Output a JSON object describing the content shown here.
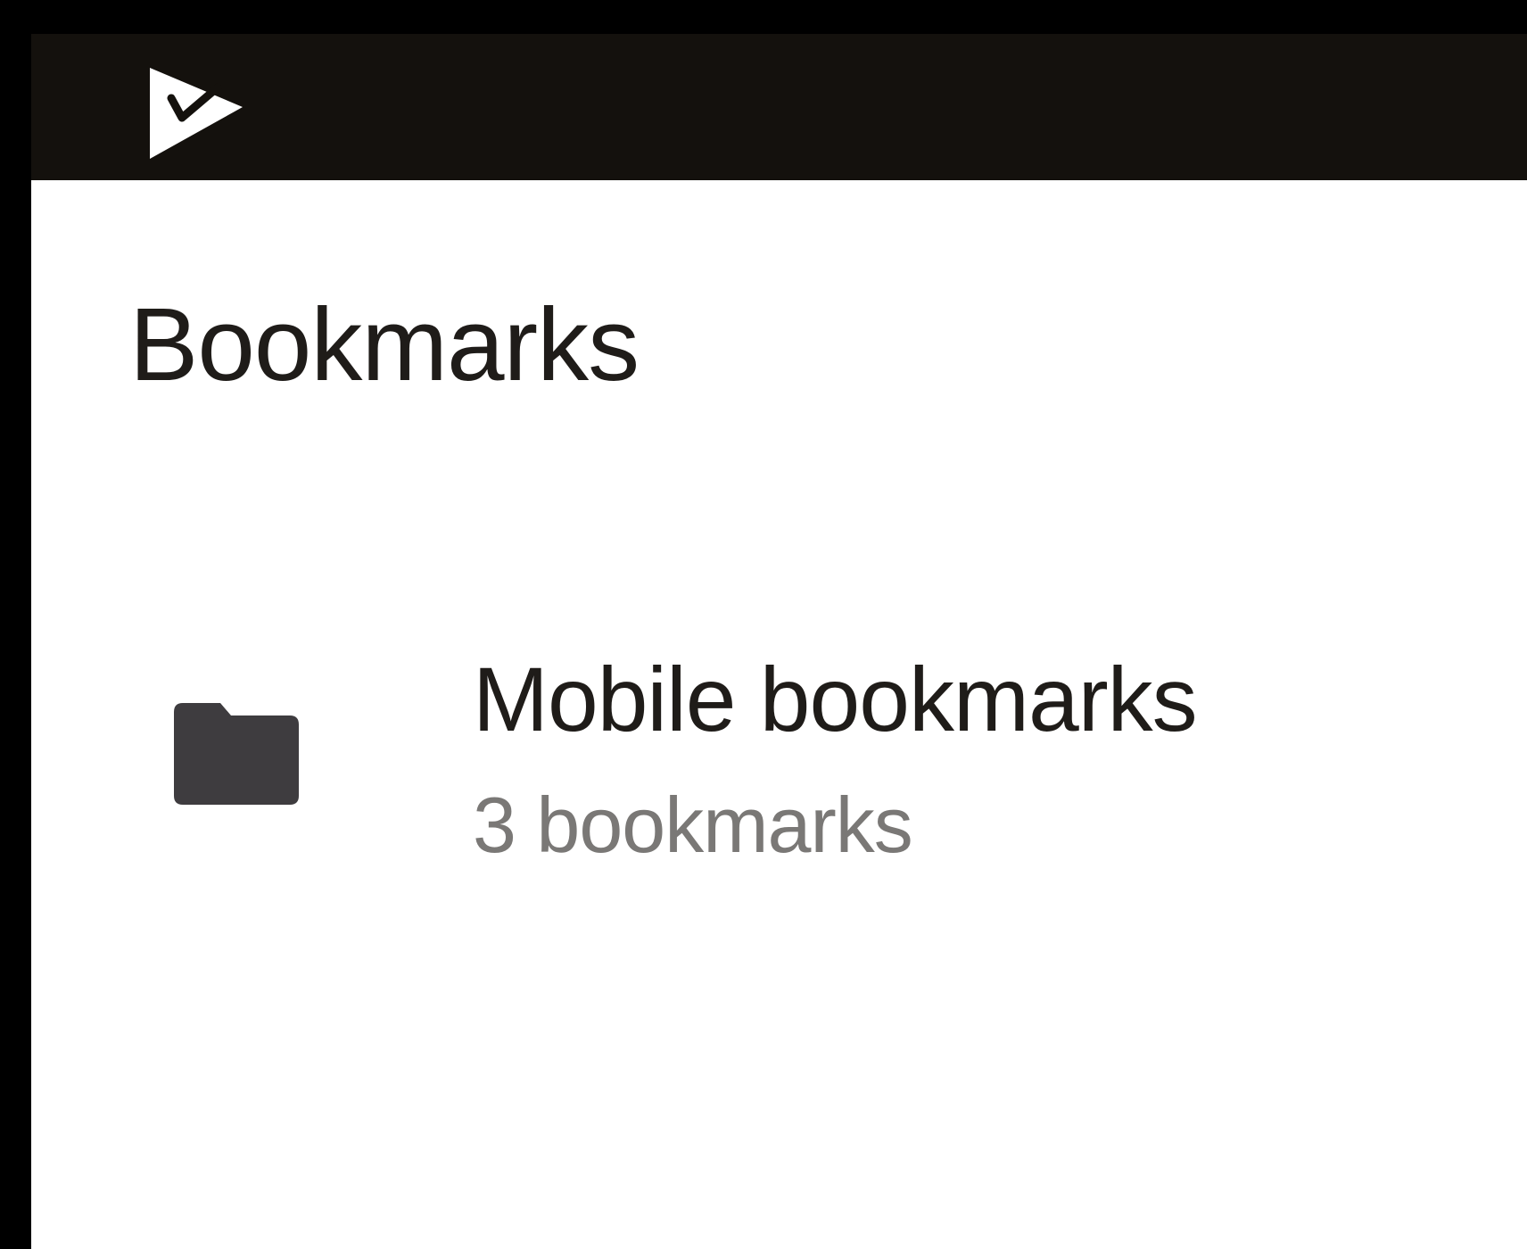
{
  "toolbar": {
    "app_icon": "app-logo-icon",
    "background_color": "#14110d"
  },
  "page": {
    "title": "Bookmarks"
  },
  "folders": [
    {
      "icon": "folder-icon",
      "name": "Mobile bookmarks",
      "count": "3 bookmarks"
    }
  ]
}
